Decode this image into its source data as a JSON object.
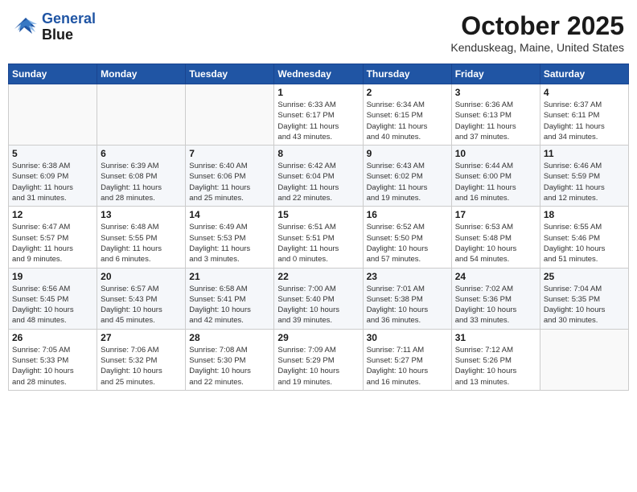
{
  "logo": {
    "line1": "General",
    "line2": "Blue"
  },
  "title": "October 2025",
  "location": "Kenduskeag, Maine, United States",
  "weekdays": [
    "Sunday",
    "Monday",
    "Tuesday",
    "Wednesday",
    "Thursday",
    "Friday",
    "Saturday"
  ],
  "weeks": [
    [
      {
        "day": "",
        "info": ""
      },
      {
        "day": "",
        "info": ""
      },
      {
        "day": "",
        "info": ""
      },
      {
        "day": "1",
        "info": "Sunrise: 6:33 AM\nSunset: 6:17 PM\nDaylight: 11 hours\nand 43 minutes."
      },
      {
        "day": "2",
        "info": "Sunrise: 6:34 AM\nSunset: 6:15 PM\nDaylight: 11 hours\nand 40 minutes."
      },
      {
        "day": "3",
        "info": "Sunrise: 6:36 AM\nSunset: 6:13 PM\nDaylight: 11 hours\nand 37 minutes."
      },
      {
        "day": "4",
        "info": "Sunrise: 6:37 AM\nSunset: 6:11 PM\nDaylight: 11 hours\nand 34 minutes."
      }
    ],
    [
      {
        "day": "5",
        "info": "Sunrise: 6:38 AM\nSunset: 6:09 PM\nDaylight: 11 hours\nand 31 minutes."
      },
      {
        "day": "6",
        "info": "Sunrise: 6:39 AM\nSunset: 6:08 PM\nDaylight: 11 hours\nand 28 minutes."
      },
      {
        "day": "7",
        "info": "Sunrise: 6:40 AM\nSunset: 6:06 PM\nDaylight: 11 hours\nand 25 minutes."
      },
      {
        "day": "8",
        "info": "Sunrise: 6:42 AM\nSunset: 6:04 PM\nDaylight: 11 hours\nand 22 minutes."
      },
      {
        "day": "9",
        "info": "Sunrise: 6:43 AM\nSunset: 6:02 PM\nDaylight: 11 hours\nand 19 minutes."
      },
      {
        "day": "10",
        "info": "Sunrise: 6:44 AM\nSunset: 6:00 PM\nDaylight: 11 hours\nand 16 minutes."
      },
      {
        "day": "11",
        "info": "Sunrise: 6:46 AM\nSunset: 5:59 PM\nDaylight: 11 hours\nand 12 minutes."
      }
    ],
    [
      {
        "day": "12",
        "info": "Sunrise: 6:47 AM\nSunset: 5:57 PM\nDaylight: 11 hours\nand 9 minutes."
      },
      {
        "day": "13",
        "info": "Sunrise: 6:48 AM\nSunset: 5:55 PM\nDaylight: 11 hours\nand 6 minutes."
      },
      {
        "day": "14",
        "info": "Sunrise: 6:49 AM\nSunset: 5:53 PM\nDaylight: 11 hours\nand 3 minutes."
      },
      {
        "day": "15",
        "info": "Sunrise: 6:51 AM\nSunset: 5:51 PM\nDaylight: 11 hours\nand 0 minutes."
      },
      {
        "day": "16",
        "info": "Sunrise: 6:52 AM\nSunset: 5:50 PM\nDaylight: 10 hours\nand 57 minutes."
      },
      {
        "day": "17",
        "info": "Sunrise: 6:53 AM\nSunset: 5:48 PM\nDaylight: 10 hours\nand 54 minutes."
      },
      {
        "day": "18",
        "info": "Sunrise: 6:55 AM\nSunset: 5:46 PM\nDaylight: 10 hours\nand 51 minutes."
      }
    ],
    [
      {
        "day": "19",
        "info": "Sunrise: 6:56 AM\nSunset: 5:45 PM\nDaylight: 10 hours\nand 48 minutes."
      },
      {
        "day": "20",
        "info": "Sunrise: 6:57 AM\nSunset: 5:43 PM\nDaylight: 10 hours\nand 45 minutes."
      },
      {
        "day": "21",
        "info": "Sunrise: 6:58 AM\nSunset: 5:41 PM\nDaylight: 10 hours\nand 42 minutes."
      },
      {
        "day": "22",
        "info": "Sunrise: 7:00 AM\nSunset: 5:40 PM\nDaylight: 10 hours\nand 39 minutes."
      },
      {
        "day": "23",
        "info": "Sunrise: 7:01 AM\nSunset: 5:38 PM\nDaylight: 10 hours\nand 36 minutes."
      },
      {
        "day": "24",
        "info": "Sunrise: 7:02 AM\nSunset: 5:36 PM\nDaylight: 10 hours\nand 33 minutes."
      },
      {
        "day": "25",
        "info": "Sunrise: 7:04 AM\nSunset: 5:35 PM\nDaylight: 10 hours\nand 30 minutes."
      }
    ],
    [
      {
        "day": "26",
        "info": "Sunrise: 7:05 AM\nSunset: 5:33 PM\nDaylight: 10 hours\nand 28 minutes."
      },
      {
        "day": "27",
        "info": "Sunrise: 7:06 AM\nSunset: 5:32 PM\nDaylight: 10 hours\nand 25 minutes."
      },
      {
        "day": "28",
        "info": "Sunrise: 7:08 AM\nSunset: 5:30 PM\nDaylight: 10 hours\nand 22 minutes."
      },
      {
        "day": "29",
        "info": "Sunrise: 7:09 AM\nSunset: 5:29 PM\nDaylight: 10 hours\nand 19 minutes."
      },
      {
        "day": "30",
        "info": "Sunrise: 7:11 AM\nSunset: 5:27 PM\nDaylight: 10 hours\nand 16 minutes."
      },
      {
        "day": "31",
        "info": "Sunrise: 7:12 AM\nSunset: 5:26 PM\nDaylight: 10 hours\nand 13 minutes."
      },
      {
        "day": "",
        "info": ""
      }
    ]
  ]
}
